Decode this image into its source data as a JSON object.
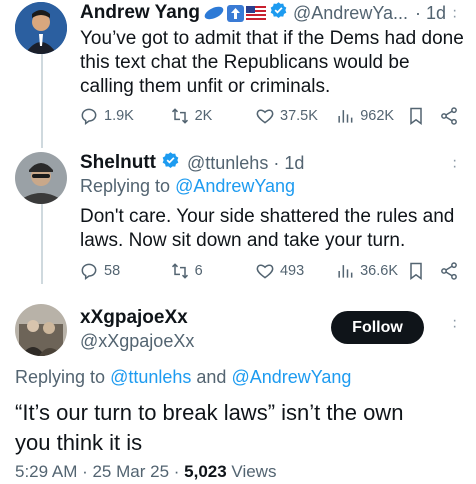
{
  "tweet1": {
    "name": "Andrew Yang",
    "handle": "@AndrewYa...",
    "time": "· 1d",
    "text_lines": [
      "You’ve got to admit that if the Dems had done",
      "this text chat the Republicans would be",
      "calling them unfit or criminals."
    ],
    "replies": "1.9K",
    "retweets": "2K",
    "likes": "37.5K",
    "views": "962K"
  },
  "tweet2": {
    "name": "Shelnutt",
    "handle": "@ttunlehs · 1d",
    "replying_prefix": "Replying to ",
    "replying_mention": "@AndrewYang",
    "text_lines": [
      "Don't care. Your side shattered the rules and",
      "laws. Now sit down and take your turn."
    ],
    "replies": "58",
    "retweets": "6",
    "likes": "493",
    "views": "36.6K"
  },
  "tweet3": {
    "name": "xXgpajoeXx",
    "handle": "@xXgpajoeXx",
    "follow_label": "Follow",
    "replying_prefix": "Replying to ",
    "replying_mention1": "@ttunlehs",
    "replying_and": " and ",
    "replying_mention2": "@AndrewYang",
    "text_lines": [
      "“It’s our turn to break laws” isn’t the own",
      "you think it is"
    ],
    "timestamp": "5:29 AM · 25 Mar 25 · ",
    "views_count": "5,023",
    "views_label": " Views"
  },
  "colors": {
    "accent": "#1d9bf0",
    "text": "#0f1419",
    "muted": "#536471"
  }
}
